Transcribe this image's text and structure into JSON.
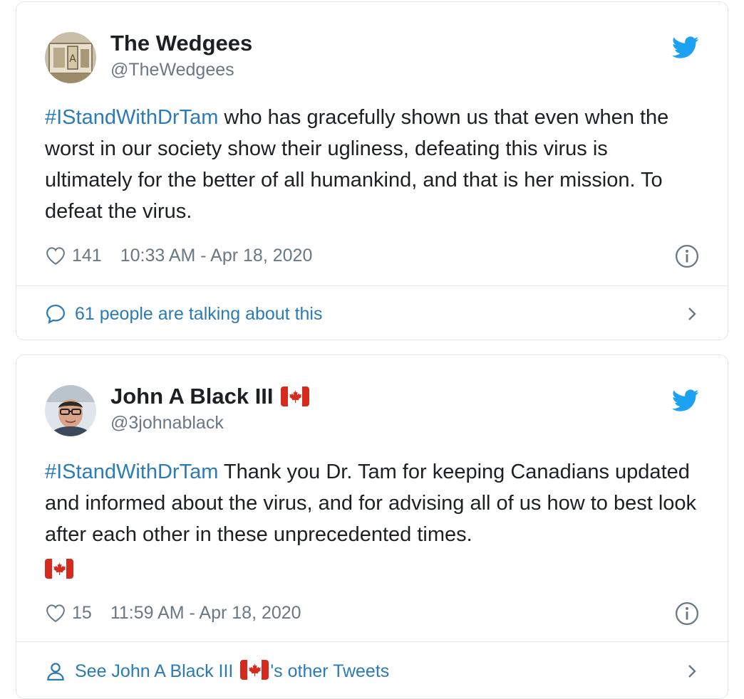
{
  "tweets": [
    {
      "display_name": "The Wedgees",
      "handle": "@TheWedgees",
      "hashtag": "#IStandWithDrTam",
      "text": " who has gracefully shown us that even when the worst in our society show their ugliness, defeating this virus is ultimately for the better of all humankind, and that is her mission. To defeat the virus.",
      "likes": "141",
      "timestamp": "10:33 AM - Apr 18, 2020",
      "footer_text": "61 people are talking about this",
      "footer_icon": "speech-bubble-icon"
    },
    {
      "display_name": "John A Black III",
      "handle": "@3johnablack",
      "hashtag": "#IStandWithDrTam",
      "text": " Thank you Dr. Tam for keeping Canadians updated and informed about the virus, and for advising all of us how to best look after each other in these unprecedented times.",
      "likes": "15",
      "timestamp": "11:59 AM - Apr 18, 2020",
      "footer_text_before": "See John A Black III",
      "footer_text_after": "'s other Tweets",
      "footer_icon": "person-icon"
    }
  ],
  "colors": {
    "link": "#2b7bb9",
    "twitter_blue": "#1da1f2",
    "muted": "#697882",
    "text": "#1c2022",
    "border": "#e1e8ed",
    "flag_red": "#d52b1e"
  }
}
